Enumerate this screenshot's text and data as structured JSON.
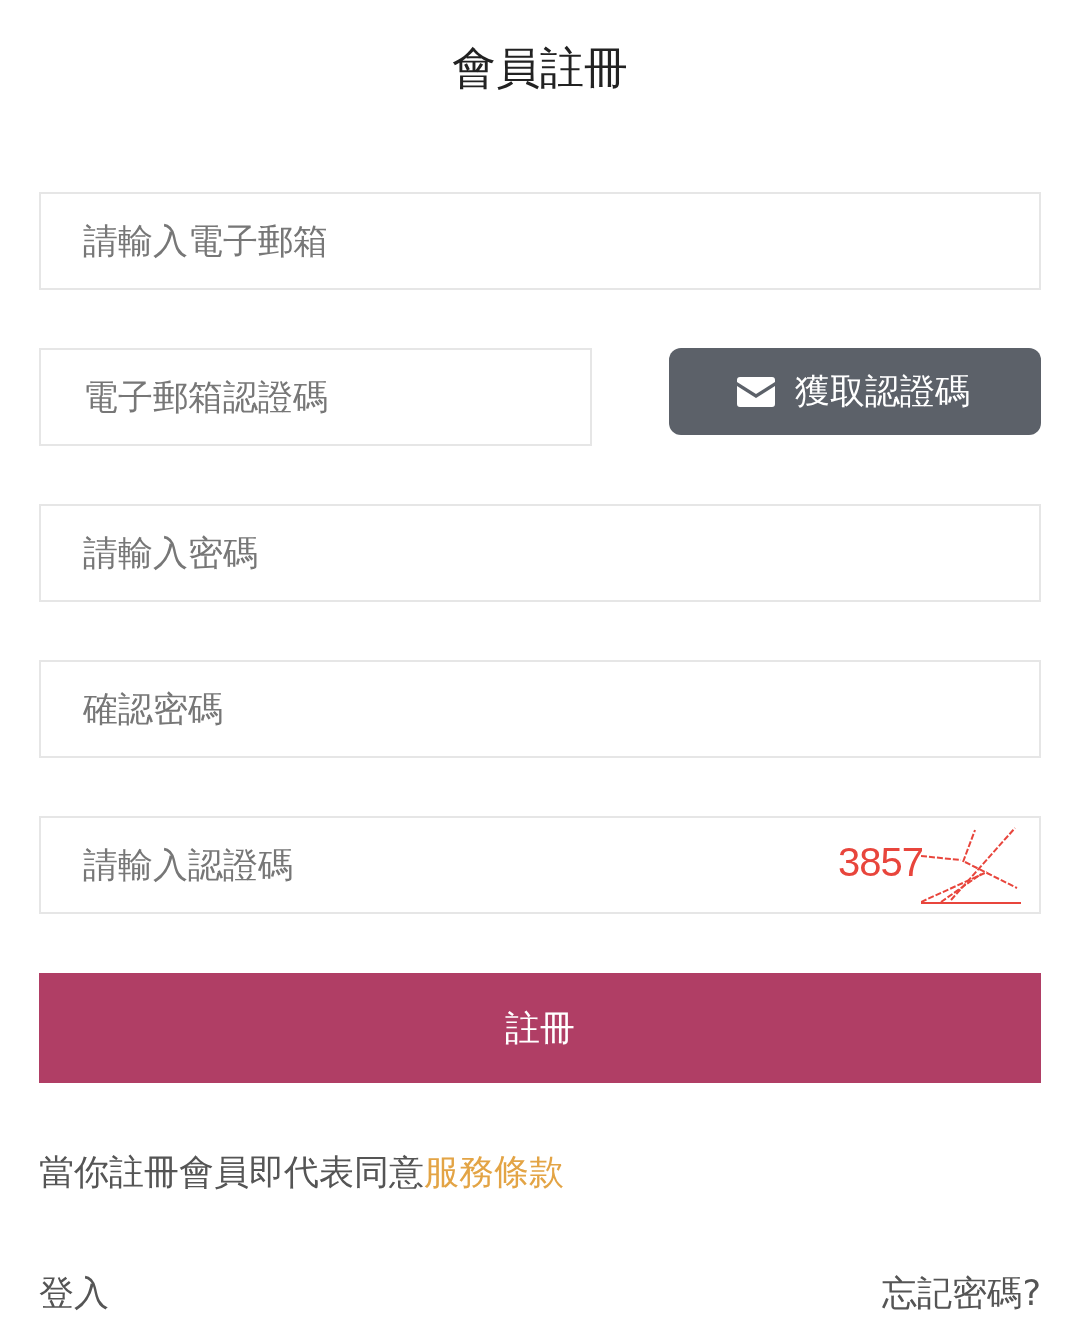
{
  "title": "會員註冊",
  "fields": [
    {
      "kind": "plain",
      "placeholder": "請輸入電子郵箱"
    },
    {
      "kind": "with_button",
      "placeholder": "電子郵箱認證碼",
      "button": "獲取認證碼"
    },
    {
      "kind": "plain",
      "placeholder": "請輸入密碼"
    },
    {
      "kind": "plain",
      "placeholder": "確認密碼"
    },
    {
      "kind": "with_captcha",
      "placeholder": "請輸入認證碼",
      "captcha": "3857"
    }
  ],
  "submit": "註冊",
  "agreement": {
    "text": "當你註冊會員即代表同意",
    "link": "服務條款"
  },
  "footer": {
    "login": "登入",
    "forgot": "忘記密碼?"
  }
}
